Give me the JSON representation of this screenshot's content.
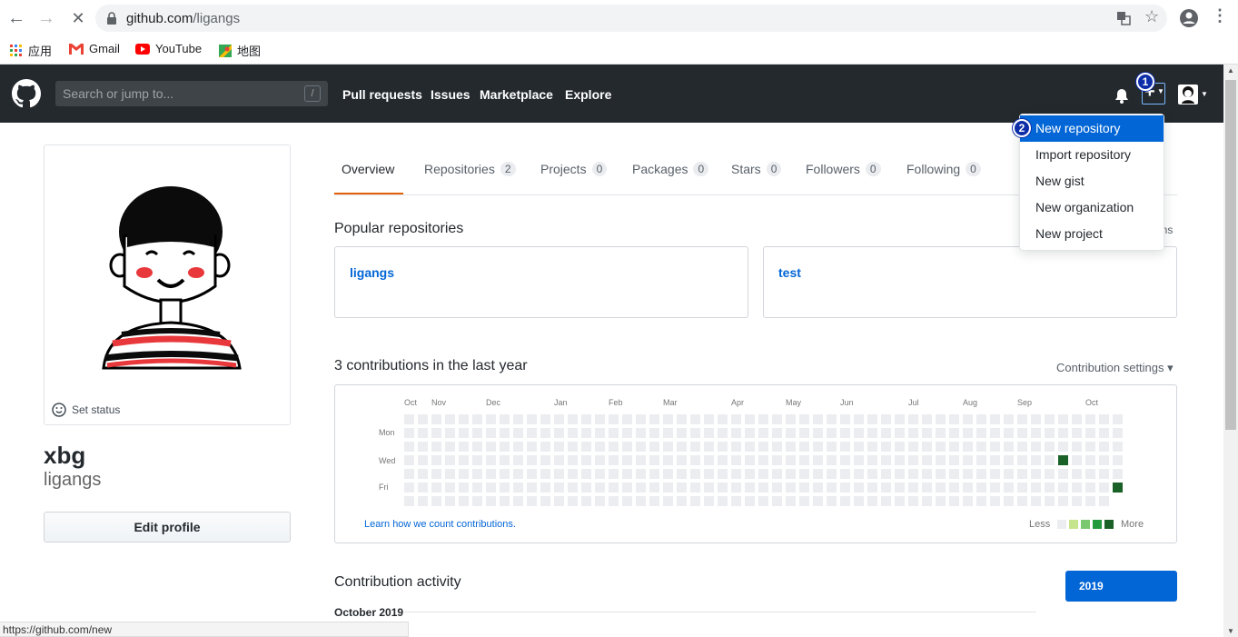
{
  "browser": {
    "url_host": "github.com",
    "url_path": "/ligangs",
    "bookmarks": [
      {
        "label": "应用",
        "icon": "apps-grid-icon"
      },
      {
        "label": "Gmail",
        "icon": "gmail-icon"
      },
      {
        "label": "YouTube",
        "icon": "youtube-icon"
      },
      {
        "label": "地图",
        "icon": "maps-icon"
      }
    ],
    "status_url": "https://github.com/new"
  },
  "header": {
    "search_placeholder": "Search or jump to...",
    "search_shortcut": "/",
    "nav": [
      "Pull requests",
      "Issues",
      "Marketplace",
      "Explore"
    ]
  },
  "profile": {
    "set_status": "Set status",
    "name": "xbg",
    "login": "ligangs",
    "edit_button": "Edit profile"
  },
  "tabs": [
    {
      "label": "Overview",
      "count": null
    },
    {
      "label": "Repositories",
      "count": "2"
    },
    {
      "label": "Projects",
      "count": "0"
    },
    {
      "label": "Packages",
      "count": "0"
    },
    {
      "label": "Stars",
      "count": "0"
    },
    {
      "label": "Followers",
      "count": "0"
    },
    {
      "label": "Following",
      "count": "0"
    }
  ],
  "popular": {
    "title": "Popular repositories",
    "customize_fragment": "ins",
    "repos": [
      "ligangs",
      "test"
    ]
  },
  "contributions": {
    "title": "3 contributions in the last year",
    "settings": "Contribution settings ▾",
    "months": [
      "Oct",
      "Nov",
      "Dec",
      "Jan",
      "Feb",
      "Mar",
      "Apr",
      "May",
      "Jun",
      "Jul",
      "Aug",
      "Sep",
      "Oct"
    ],
    "weekdays": [
      "Mon",
      "Wed",
      "Fri"
    ],
    "learn": "Learn how we count contributions.",
    "less": "Less",
    "more": "More",
    "legend_colors": [
      "#ebedf0",
      "#c6e48b",
      "#7bc96f",
      "#239a3b",
      "#196127"
    ]
  },
  "activity": {
    "title": "Contribution activity",
    "year": "2019",
    "month": "October 2019"
  },
  "dropdown": {
    "items": [
      "New repository",
      "Import repository",
      "New gist",
      "New organization",
      "New project"
    ],
    "active_index": 0
  },
  "annotations": [
    "1",
    "2"
  ]
}
